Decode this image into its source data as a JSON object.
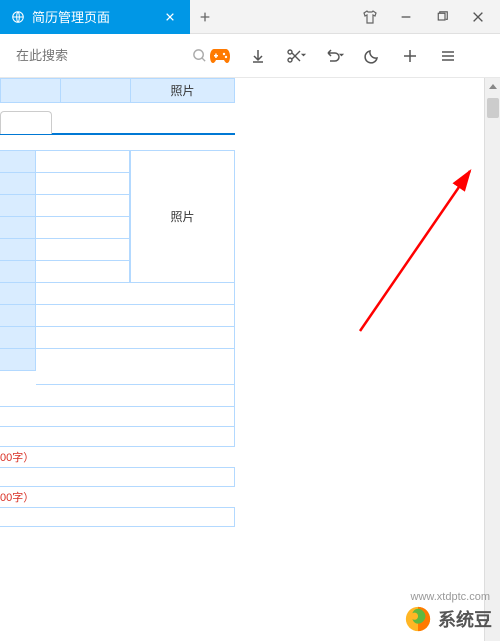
{
  "tab": {
    "title": "简历管理页面"
  },
  "search": {
    "placeholder": "在此搜索"
  },
  "content": {
    "photo_header": "照片",
    "photo_label": "照片",
    "red_hint1": "00字）",
    "red_hint2": "00字）"
  },
  "watermark": {
    "name": "系统豆",
    "url": "www.xtdptc.com"
  }
}
